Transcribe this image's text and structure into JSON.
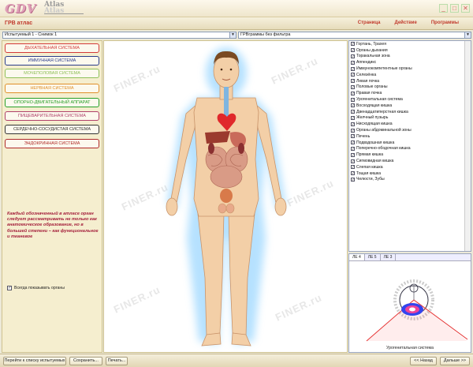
{
  "titlebar": {
    "logo_main": "GDV",
    "logo_atlas": "Atlas",
    "logo_sub": "Atlas"
  },
  "menubar": {
    "app_name": "ГРВ атлас",
    "items": [
      "Страница",
      "Действие",
      "Программы"
    ]
  },
  "toolbar": {
    "subject_select": "Испытуемый 1 - Снимок 1",
    "filter_select": "ГРВграммы без фильтра"
  },
  "systems": [
    {
      "label": "ДЫХАТЕЛЬНАЯ СИСТЕМА",
      "color": "#d23a3a"
    },
    {
      "label": "ИММУННАЯ СИСТЕМА",
      "color": "#2a3c8c"
    },
    {
      "label": "МОЧЕПОЛОВАЯ СИСТЕМА",
      "color": "#8fc05a"
    },
    {
      "label": "НЕРВНАЯ СИСТЕМА",
      "color": "#e0902a"
    },
    {
      "label": "ОПОРНО-ДВИГАТЕЛЬНЫЙ АППАРАТ",
      "color": "#27a02a"
    },
    {
      "label": "ПИЩЕВАРИТЕЛЬНАЯ СИСТЕМА",
      "color": "#b0406a"
    },
    {
      "label": "СЕРДЕЧНО-СОСУДИСТАЯ СИСТЕМА",
      "color": "#333333"
    },
    {
      "label": "ЭНДОКРИННАЯ СИСТЕМА",
      "color": "#b02a2a"
    }
  ],
  "note": "Каждый обозначенный в атласе орган следует рассматривать не только как анатомическое образование, но в большей степени – как функциональное и тканевое",
  "always_show": {
    "label": "Всегда показывать органы",
    "checked": "✓"
  },
  "organs": [
    "Гортань, Трахея",
    "Органы дыхания",
    "Торакальная зона",
    "Аппендикс",
    "Иммунокомпетентные органы",
    "Селезёнка",
    "Левая почка",
    "Половые органы",
    "Правая почка",
    "Урогенитальная система",
    "Восходящая кишка",
    "Двенадцатиперстная кишка",
    "Желчный пузырь",
    "Нисходящая кишка",
    "Органы абдоминальной зоны",
    "Печень",
    "Подвздошная кишка",
    "Поперечно-ободочная кишка",
    "Прямая кишка",
    "Сигмовидная кишка",
    "Слепая кишка",
    "Тощая кишка",
    "Челюсти, Зубы"
  ],
  "diag": {
    "tabs": [
      "ЛЕ 4",
      "ЛЕ 5",
      "ЛЕ 3"
    ],
    "caption": "Урогенитальная система"
  },
  "watermark": "FINER.ru",
  "bottom": {
    "go_list": "Перейти к списку испытуемых",
    "save": "Сохранить...",
    "print": "Печать...",
    "back": "<< Назад",
    "next": "Дальше >>"
  }
}
